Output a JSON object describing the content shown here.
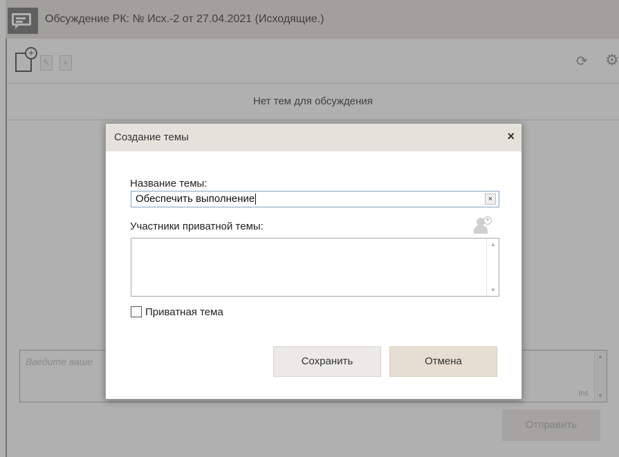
{
  "window": {
    "title": "Обсуждение РК: № Исх.-2 от 27.04.2021 (Исходящие.)"
  },
  "toolbar": {
    "icons": [
      "new-topic-icon",
      "edit-topic-icon",
      "delete-topic-icon",
      "refresh-icon",
      "settings-icon"
    ]
  },
  "topics": {
    "empty_text": "Нет тем для обсуждения"
  },
  "message": {
    "placeholder": "Введите ваше",
    "ins_label": "Ins",
    "send_label": "Отправить"
  },
  "dialog": {
    "title": "Создание темы",
    "close_glyph": "×",
    "name_label": "Название темы:",
    "name_value": "Обеспечить выполнение",
    "clear_glyph": "×",
    "members_label": "Участники приватной темы:",
    "private_label": "Приватная тема",
    "private_checked": false,
    "save_label": "Сохранить",
    "cancel_label": "Отмена"
  }
}
